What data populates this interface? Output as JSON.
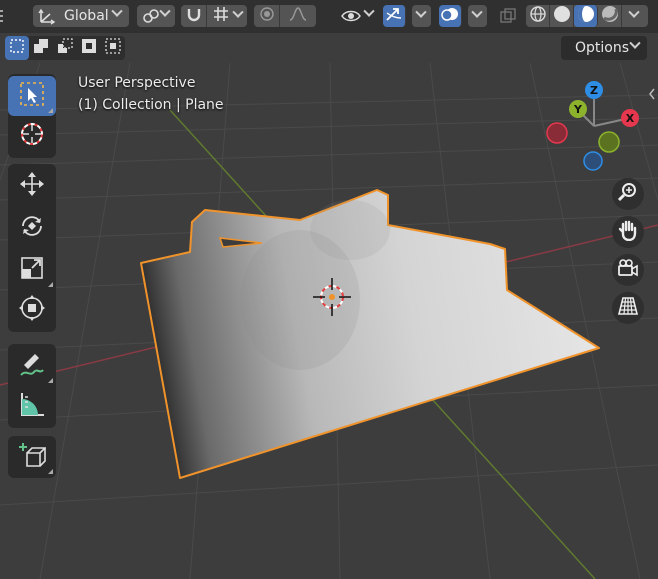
{
  "header": {
    "transform_orientation": "Global"
  },
  "options_label": "Options",
  "overlay": {
    "view_name": "User Perspective",
    "object_info": "(1) Collection | Plane"
  },
  "gizmo": {
    "x_label": "X",
    "y_label": "Y",
    "z_label": "Z"
  },
  "colors": {
    "accent": "#4772b3",
    "selection_outline": "#f0932b",
    "axis_x": "#e5384e",
    "axis_y": "#8db32d",
    "axis_z": "#2e8ee6"
  },
  "toolbar": {
    "tools": [
      "select-box",
      "cursor",
      "move",
      "rotate",
      "scale",
      "transform",
      "annotate",
      "measure",
      "add-cube"
    ],
    "active_tool": "select-box"
  },
  "icons": [
    "select-box-icon",
    "cursor-icon",
    "move-icon",
    "rotate-icon",
    "scale-icon",
    "transform-icon",
    "annotate-icon",
    "measure-icon",
    "add-cube-icon",
    "zoom-icon",
    "hand-icon",
    "camera-icon",
    "grid-icon"
  ]
}
